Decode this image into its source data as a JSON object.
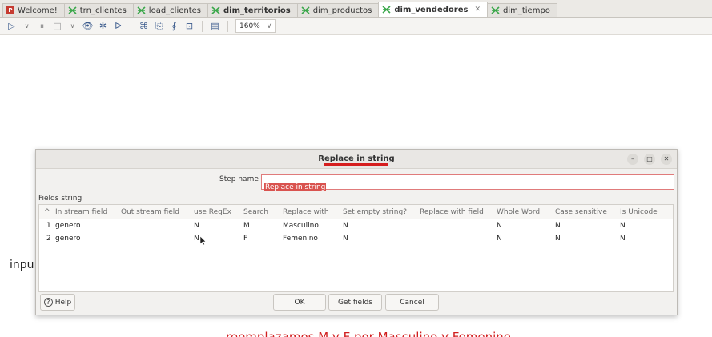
{
  "tabs": [
    {
      "label": "Welcome!",
      "icon": "welcome-icon",
      "active": false
    },
    {
      "label": "trn_clientes",
      "icon": "transformation-icon",
      "active": false
    },
    {
      "label": "load_clientes",
      "icon": "transformation-icon",
      "active": false
    },
    {
      "label": "dim_territorios",
      "icon": "transformation-icon",
      "active": false
    },
    {
      "label": "dim_productos",
      "icon": "transformation-icon",
      "active": false
    },
    {
      "label": "dim_vendedores",
      "icon": "transformation-icon",
      "active": true,
      "close": "✕"
    },
    {
      "label": "dim_tiempo",
      "icon": "transformation-icon",
      "active": false
    }
  ],
  "toolbar": {
    "zoom": "160%",
    "zoom_caret": "∨"
  },
  "canvas": {
    "partial_label": "inpu"
  },
  "dialog": {
    "title": "Replace in string",
    "step_name_label": "Step name",
    "step_name_value": "Replace in string",
    "fields_label": "Fields string",
    "columns": [
      "#",
      "In stream field",
      "Out stream field",
      "use RegEx",
      "Search",
      "Replace with",
      "Set empty string?",
      "Replace with field",
      "Whole Word",
      "Case sensitive",
      "Is Unicode"
    ],
    "rows": [
      [
        "1",
        "genero",
        "",
        "N",
        "M",
        "Masculino",
        "N",
        "",
        "N",
        "N",
        "N"
      ],
      [
        "2",
        "genero",
        "",
        "N",
        "F",
        "Femenino",
        "N",
        "",
        "N",
        "N",
        "N"
      ]
    ],
    "annotation": "reemplazamos M y F por Masculino y Femenino",
    "buttons": {
      "help": "Help",
      "ok": "OK",
      "get_fields": "Get fields",
      "cancel": "Cancel"
    }
  },
  "colors": {
    "accent_red": "#d61e1e",
    "spoon_green": "#3aa74a"
  }
}
